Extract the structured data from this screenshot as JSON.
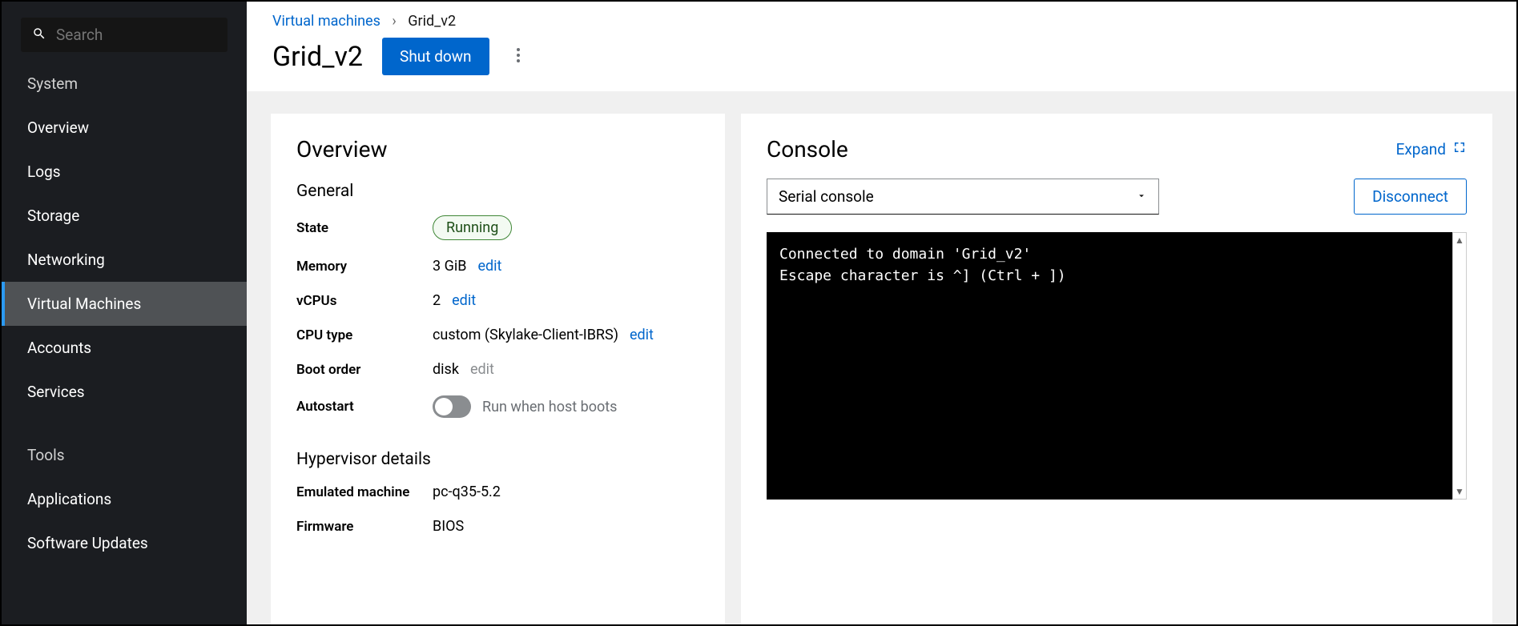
{
  "sidebar": {
    "search_placeholder": "Search",
    "sections": [
      {
        "label": "System",
        "items": [
          {
            "label": "Overview"
          },
          {
            "label": "Logs"
          },
          {
            "label": "Storage"
          },
          {
            "label": "Networking"
          },
          {
            "label": "Virtual Machines",
            "active": true
          },
          {
            "label": "Accounts"
          },
          {
            "label": "Services"
          }
        ]
      },
      {
        "label": "Tools",
        "items": [
          {
            "label": "Applications"
          },
          {
            "label": "Software Updates"
          }
        ]
      }
    ]
  },
  "breadcrumbs": {
    "root": "Virtual machines",
    "current": "Grid_v2"
  },
  "header": {
    "title": "Grid_v2",
    "shutdown_label": "Shut down"
  },
  "overview": {
    "panel_title": "Overview",
    "general_title": "General",
    "state_label": "State",
    "state_value": "Running",
    "memory_label": "Memory",
    "memory_value": "3 GiB",
    "vcpus_label": "vCPUs",
    "vcpus_value": "2",
    "cputype_label": "CPU type",
    "cputype_value": "custom (Skylake-Client-IBRS)",
    "boot_label": "Boot order",
    "boot_value": "disk",
    "autostart_label": "Autostart",
    "autostart_note": "Run when host boots",
    "edit_label": "edit",
    "hypervisor_title": "Hypervisor details",
    "emu_label": "Emulated machine",
    "emu_value": "pc-q35-5.2",
    "fw_label": "Firmware",
    "fw_value": "BIOS"
  },
  "console": {
    "panel_title": "Console",
    "expand_label": "Expand",
    "select_value": "Serial console",
    "disconnect_label": "Disconnect",
    "terminal_text": "Connected to domain 'Grid_v2'\nEscape character is ^] (Ctrl + ])"
  }
}
